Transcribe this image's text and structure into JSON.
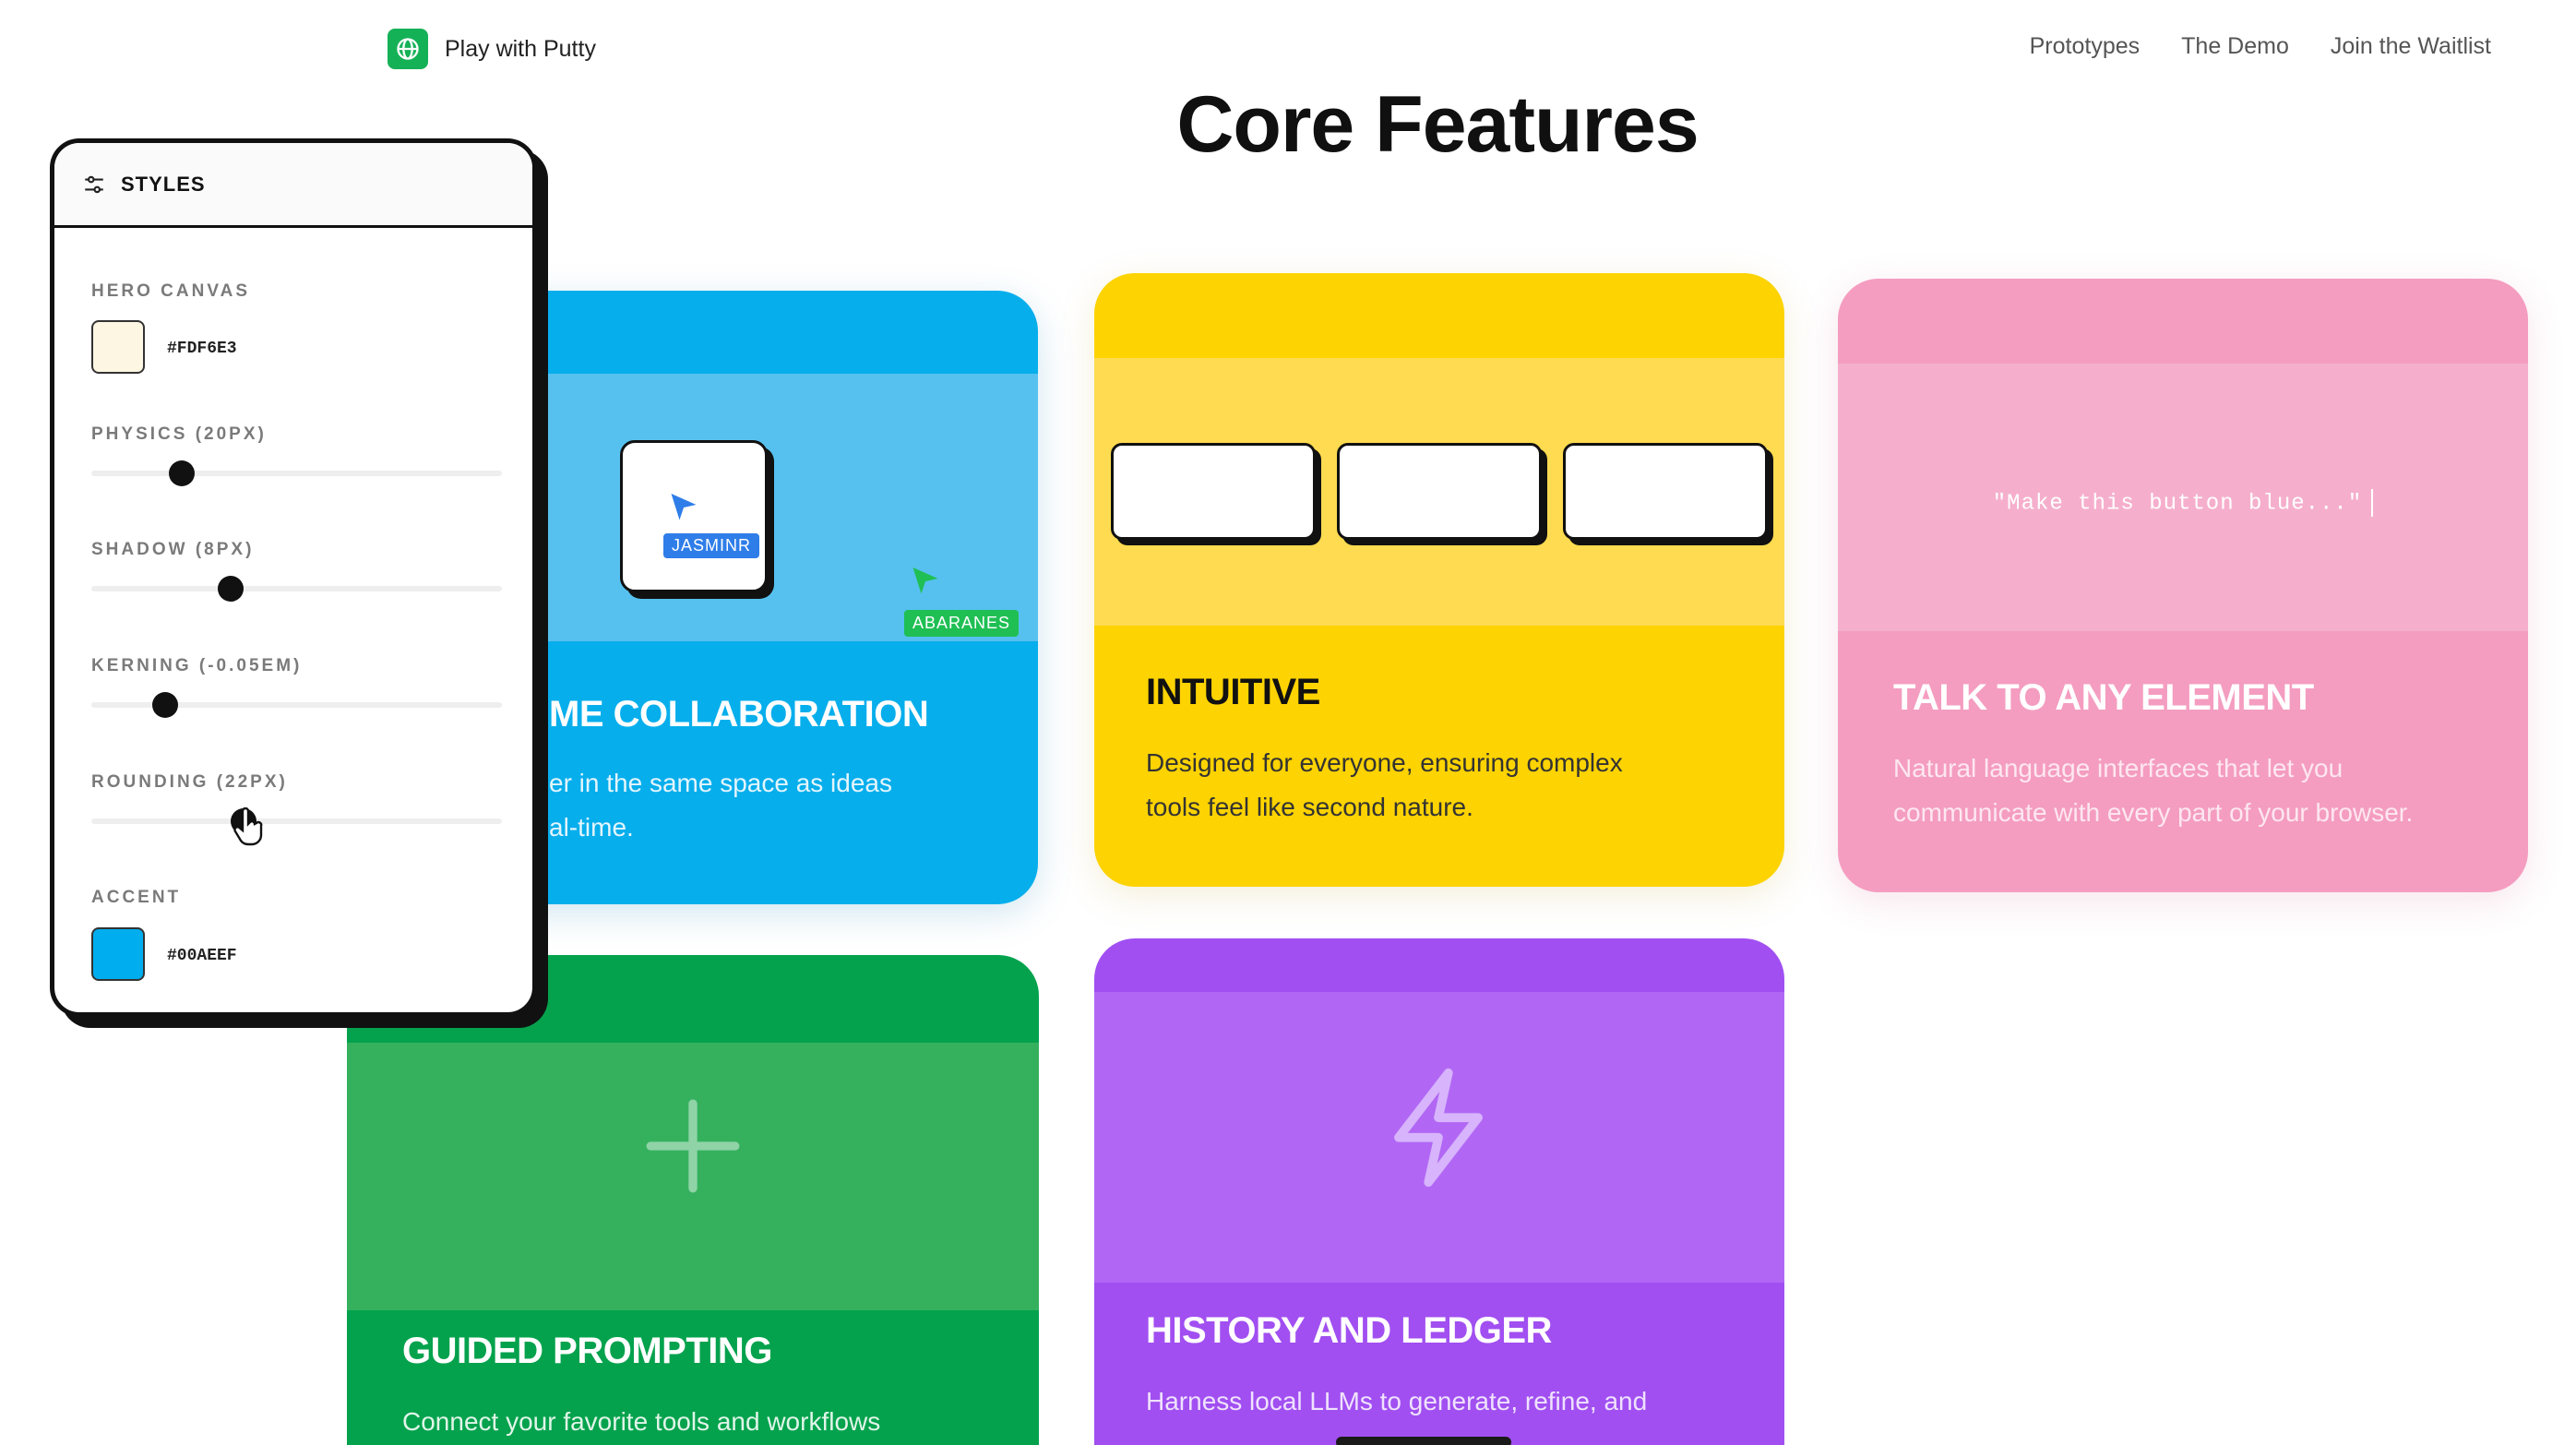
{
  "nav": {
    "brand": "Play with Putty",
    "links": [
      "Prototypes",
      "The Demo",
      "Join the Waitlist"
    ]
  },
  "page": {
    "title": "Core Features"
  },
  "cards": {
    "collaboration": {
      "title": "ME COLLABORATION",
      "desc_line1": "er in the same space as ideas",
      "desc_line2": "al-time.",
      "tags": [
        "JASMINR",
        "ABARANES"
      ]
    },
    "intuitive": {
      "title": "INTUITIVE",
      "desc_line1": "Designed for everyone, ensuring complex",
      "desc_line2": "tools feel like second nature."
    },
    "talk": {
      "title": "TALK TO ANY ELEMENT",
      "prompt": "\"Make this button blue...\"",
      "desc_line1": "Natural language interfaces that let you",
      "desc_line2": "communicate with every part of your browser."
    },
    "guided": {
      "title": "GUIDED PROMPTING",
      "desc_line1": "Connect your favorite tools and workflows"
    },
    "history": {
      "title": "HISTORY AND LEDGER",
      "desc_line1": "Harness local LLMs to generate, refine, and"
    }
  },
  "styles_panel": {
    "title": "STYLES",
    "hero_canvas": {
      "label": "HERO CANVAS",
      "value": "#FDF6E3"
    },
    "physics": {
      "label": "PHYSICS (20PX)",
      "fraction": 0.22
    },
    "shadow": {
      "label": "SHADOW (8PX)",
      "fraction": 0.34
    },
    "kerning": {
      "label": "KERNING (-0.05EM)",
      "fraction": 0.18
    },
    "rounding": {
      "label": "ROUNDING (22PX)",
      "fraction": 0.37
    },
    "accent": {
      "label": "ACCENT",
      "value": "#00AEEF"
    }
  },
  "colors": {
    "brand_green": "#15b157",
    "card_blue": "#07aeec",
    "card_yellow": "#fdd301",
    "card_pink": "#f49dc0",
    "card_green": "#04a24d",
    "card_purple": "#a14ff1"
  },
  "icons": [
    "globe-icon",
    "sliders-icon",
    "cursor-arrow-icon",
    "plus-icon",
    "lightning-bolt-icon",
    "hand-pointer-icon"
  ]
}
